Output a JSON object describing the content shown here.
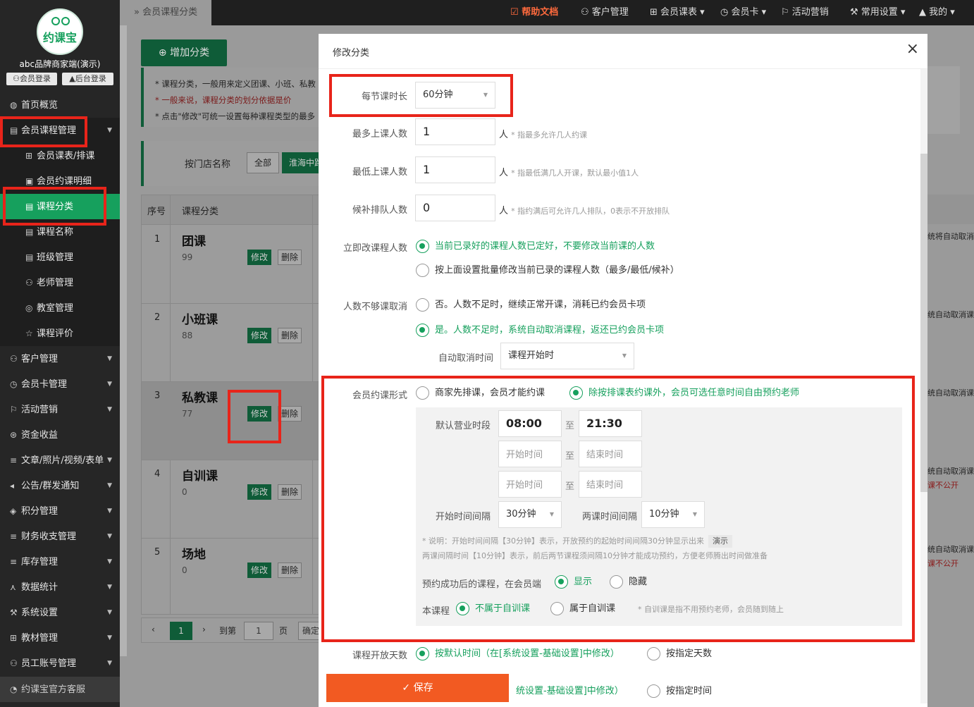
{
  "sidebar": {
    "logo_text": "约课宝",
    "brand": "abc品牌商家端(演示)",
    "member_login": "会员登录",
    "admin_login": "后台登录",
    "items": [
      {
        "label": "首页概览",
        "icon": "◍"
      },
      {
        "label": "会员课程管理",
        "icon": "▤"
      },
      {
        "label": "会员课表/排课",
        "icon": "⊞"
      },
      {
        "label": "会员约课明细",
        "icon": "▣"
      },
      {
        "label": "课程分类",
        "icon": "▤"
      },
      {
        "label": "课程名称",
        "icon": "▤"
      },
      {
        "label": "班级管理",
        "icon": "▤"
      },
      {
        "label": "老师管理",
        "icon": "⚇"
      },
      {
        "label": "教室管理",
        "icon": "◎"
      },
      {
        "label": "课程评价",
        "icon": "☆"
      },
      {
        "label": "客户管理",
        "icon": "⚇"
      },
      {
        "label": "会员卡管理",
        "icon": "◷"
      },
      {
        "label": "活动营销",
        "icon": "⚐"
      },
      {
        "label": "资金收益",
        "icon": "⊛"
      },
      {
        "label": "文章/照片/视频/表单",
        "icon": "≡"
      },
      {
        "label": "公告/群发通知",
        "icon": "◂"
      },
      {
        "label": "积分管理",
        "icon": "◈"
      },
      {
        "label": "财务收支管理",
        "icon": "≡"
      },
      {
        "label": "库存管理",
        "icon": "≡"
      },
      {
        "label": "数据统计",
        "icon": "⋏"
      },
      {
        "label": "系统设置",
        "icon": "⚒"
      },
      {
        "label": "教材管理",
        "icon": "⊞"
      },
      {
        "label": "员工账号管理",
        "icon": "⚇"
      }
    ],
    "footer": "约课宝官方客服"
  },
  "topbar": {
    "breadcrumb": "会员课程分类",
    "menu": [
      "帮助文档",
      "客户管理",
      "会员课表",
      "会员卡",
      "活动营销",
      "常用设置",
      "我的"
    ]
  },
  "page": {
    "add_button": "增加分类",
    "notes": [
      "* 课程分类，一般用来定义团课、小班、私教",
      "* 一般来说，课程分类的划分依据是价",
      "* 点击\"修改\"可统一设置每种课程类型的最多"
    ],
    "filter": {
      "label": "按门店名称",
      "all": "全部",
      "store": "淮海中路店"
    },
    "table": {
      "headers": [
        "序号",
        "课程分类"
      ],
      "edit": "修改",
      "delete": "删除",
      "rows": [
        {
          "no": "1",
          "name": "团课",
          "count": "99"
        },
        {
          "no": "2",
          "name": "小班课",
          "count": "88"
        },
        {
          "no": "3",
          "name": "私教课",
          "count": "77"
        },
        {
          "no": "4",
          "name": "自训课",
          "count": "0"
        },
        {
          "no": "5",
          "name": "场地",
          "count": "0"
        }
      ]
    },
    "pagination": {
      "current": "1",
      "goto": "到第",
      "page_input": "1",
      "page_unit": "页",
      "confirm": "确定"
    },
    "right_col": [
      {
        "a": "统将自动取消",
        "b": ""
      },
      {
        "a": "统自动取消课",
        "b": ""
      },
      {
        "a": "统自动取消课",
        "b": ""
      },
      {
        "a": "统自动取消课",
        "b": "课不公开"
      },
      {
        "a": "统自动取消课",
        "b": "课不公开"
      }
    ]
  },
  "modal": {
    "title": "修改分类",
    "close": "×",
    "duration": {
      "label": "每节课时长",
      "value": "60分钟"
    },
    "max": {
      "label": "最多上课人数",
      "value": "1",
      "unit": "人",
      "hint": "* 指最多允许几人约课"
    },
    "min": {
      "label": "最低上课人数",
      "value": "1",
      "unit": "人",
      "hint": "* 指最低满几人开课，默认最小值1人"
    },
    "wait": {
      "label": "候补排队人数",
      "value": "0",
      "unit": "人",
      "hint": "* 指约满后可允许几人排队，0表示不开放排队"
    },
    "change_now": {
      "label": "立即改课程人数",
      "opt1": "当前已录好的课程人数已定好，不要修改当前课的人数",
      "opt2": "按上面设置批量修改当前已录的课程人数（最多/最低/候补）"
    },
    "cancel": {
      "label": "人数不够课取消",
      "opt1": "否。人数不足时，继续正常开课，消耗已约会员卡项",
      "opt2": "是。人数不足时，系统自动取消课程，返还已约会员卡项",
      "auto_label": "自动取消时间",
      "auto_value": "课程开始时"
    },
    "booking": {
      "label": "会员约课形式",
      "opt1": "商家先排课，会员才能约课",
      "opt2": "除按排课表约课外，会员可选任意时间自由预约老师",
      "hours_label": "默认营业时段",
      "start": "08:00",
      "to": "至",
      "end": "21:30",
      "start_ph": "开始时间",
      "end_ph": "结束时间",
      "interval_label": "开始时间间隔",
      "interval": "30分钟",
      "gap_label": "两课时间间隔",
      "gap": "10分钟",
      "desc1": "* 说明：开始时间间隔【30分钟】表示，开放预约的起始时间间隔30分钟显示出来",
      "demo": "演示",
      "desc2": "两课间隔时间【10分钟】表示，前后两节课程须间隔10分钟才能成功预约，方便老师腾出时间做准备",
      "show_label": "预约成功后的课程，在会员端",
      "show": "显示",
      "hide": "隐藏",
      "self_label": "本课程",
      "not_self": "不属于自训课",
      "is_self": "属于自训课",
      "self_hint": "* 自训课是指不用预约老师，会员随到随上"
    },
    "open_days": {
      "label": "课程开放天数",
      "opt1": "按默认时间（在[系统设置-基础设置]中修改）",
      "opt2": "按指定天数"
    },
    "open_time": {
      "opt1": "统设置-基础设置]中修改）",
      "opt2": "按指定时间"
    },
    "save": "保存"
  },
  "colors": {
    "accent": "#16a05d",
    "danger": "#e8241a",
    "save": "#f25a22"
  }
}
